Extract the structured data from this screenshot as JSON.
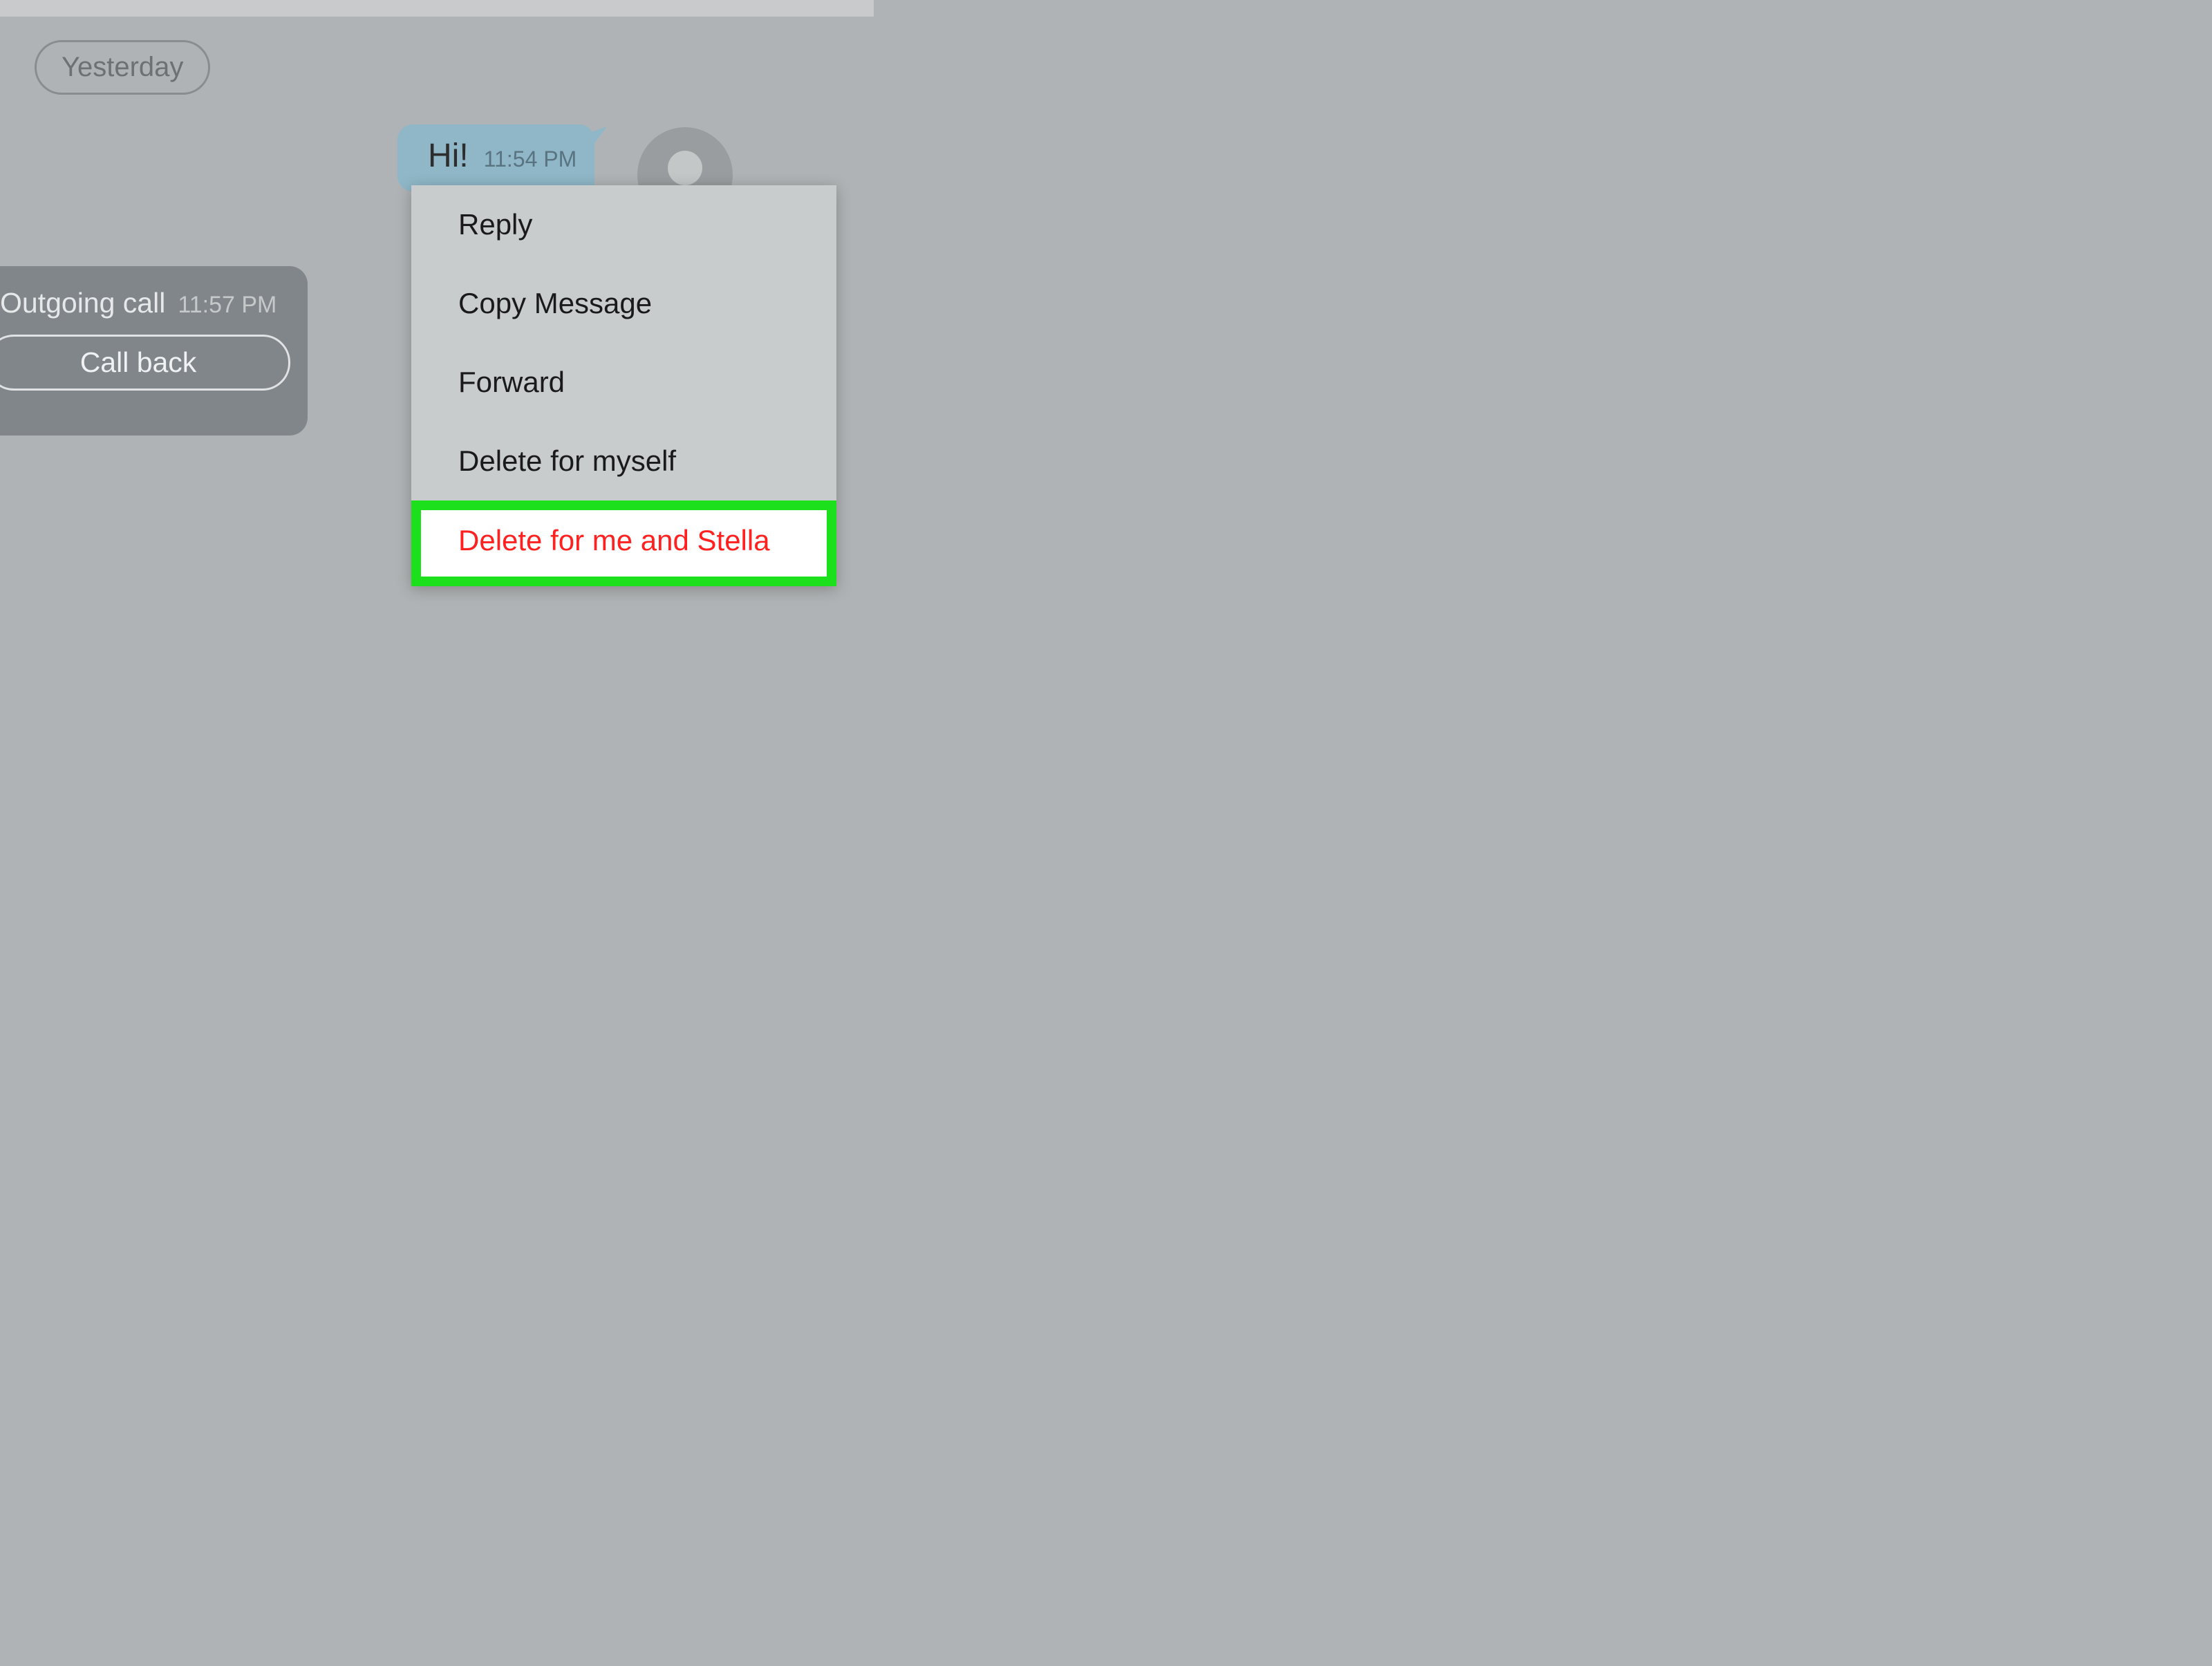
{
  "date_label": "Yesterday",
  "call": {
    "title": "Outgoing call",
    "time": "11:57 PM",
    "callback_label": "Call back"
  },
  "message": {
    "text": "Hi!",
    "time": "11:54 PM"
  },
  "context_menu": {
    "items": [
      {
        "label": "Reply"
      },
      {
        "label": "Copy Message"
      },
      {
        "label": "Forward"
      },
      {
        "label": "Delete for myself"
      },
      {
        "label": "Delete for me and Stella",
        "highlighted": true
      }
    ]
  }
}
